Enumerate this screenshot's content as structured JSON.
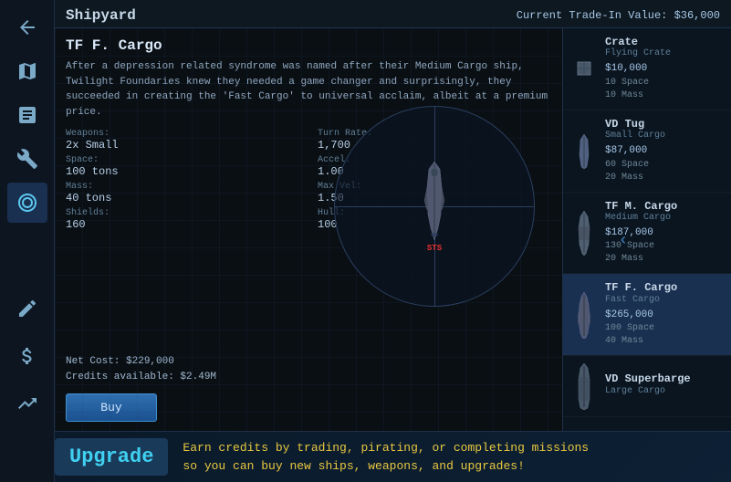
{
  "header": {
    "title": "Shipyard",
    "trade_value_label": "Current Trade-In Value: $36,000"
  },
  "ship": {
    "name": "TF F. Cargo",
    "description": "After a depression related syndrome was named after their Medium Cargo ship, Twilight Foundaries knew they needed a game changer and surprisingly, they succeeded in creating the 'Fast Cargo' to universal acclaim, albeit at a premium price.",
    "weapons_label": "Weapons:",
    "weapons_value": "2x Small",
    "turn_rate_label": "Turn Rate:",
    "turn_rate_value": "1,700",
    "space_label": "Space:",
    "space_value": "100 tons",
    "accel_label": "Accel:",
    "accel_value": "1.00",
    "mass_label": "Mass:",
    "mass_value": "40 tons",
    "max_vel_label": "Max Vel:",
    "max_vel_value": "1.50",
    "shields_label": "Shields:",
    "shields_value": "160",
    "hull_label": "Hull:",
    "hull_value": "100",
    "net_cost": "Net Cost: $229,000",
    "credits_available": "Credits available: $2.49M",
    "sprite_label": "STS"
  },
  "buy_button": "Buy",
  "ship_list": [
    {
      "name": "Crate",
      "type": "Flying Crate",
      "price": "$10,000",
      "stat1": "10 Space",
      "stat2": "10 Mass",
      "selected": false,
      "thumb_type": "crate"
    },
    {
      "name": "VD Tug",
      "type": "Small Cargo",
      "price": "$87,000",
      "stat1": "60 Space",
      "stat2": "20 Mass",
      "selected": false,
      "thumb_type": "tug"
    },
    {
      "name": "TF M. Cargo",
      "type": "Medium Cargo",
      "price": "$187,000",
      "stat1": "130 Space",
      "stat2": "20 Mass",
      "selected": false,
      "thumb_type": "medium"
    },
    {
      "name": "TF F. Cargo",
      "type": "Fast Cargo",
      "price": "$265,000",
      "stat1": "100 Space",
      "stat2": "40 Mass",
      "selected": true,
      "thumb_type": "fast"
    },
    {
      "name": "VD Superbarge",
      "type": "Large Cargo",
      "price": "",
      "stat1": "",
      "stat2": "",
      "selected": false,
      "thumb_type": "barge"
    }
  ],
  "sidebar": {
    "icons": [
      {
        "name": "back-icon",
        "symbol": "↩",
        "active": false
      },
      {
        "name": "map-icon",
        "symbol": "🗺",
        "active": false
      },
      {
        "name": "cargo-icon",
        "symbol": "📋",
        "active": false
      },
      {
        "name": "tools-icon",
        "symbol": "✦",
        "active": false
      },
      {
        "name": "ship-icon",
        "symbol": "⚙",
        "active": true
      },
      {
        "name": "crew-icon",
        "symbol": "✎",
        "active": false
      },
      {
        "name": "trade-icon",
        "symbol": "$",
        "active": false
      },
      {
        "name": "stats-icon",
        "symbol": "📈",
        "active": false
      }
    ]
  },
  "upgrade": {
    "label": "Upgrade",
    "text": "Earn credits by trading, pirating, or completing missions\nso you can buy new ships, weapons, and upgrades!"
  }
}
